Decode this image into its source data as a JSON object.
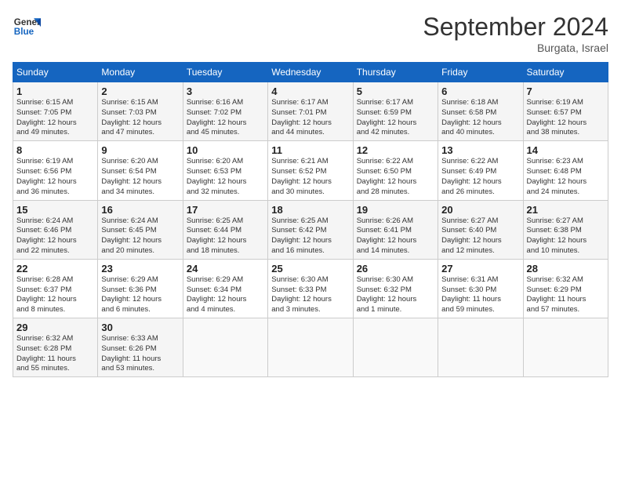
{
  "logo": {
    "line1": "General",
    "line2": "Blue"
  },
  "title": "September 2024",
  "location": "Burgata, Israel",
  "days_of_week": [
    "Sunday",
    "Monday",
    "Tuesday",
    "Wednesday",
    "Thursday",
    "Friday",
    "Saturday"
  ],
  "weeks": [
    [
      {
        "day": 1,
        "info": "Sunrise: 6:15 AM\nSunset: 7:05 PM\nDaylight: 12 hours\nand 49 minutes."
      },
      {
        "day": 2,
        "info": "Sunrise: 6:15 AM\nSunset: 7:03 PM\nDaylight: 12 hours\nand 47 minutes."
      },
      {
        "day": 3,
        "info": "Sunrise: 6:16 AM\nSunset: 7:02 PM\nDaylight: 12 hours\nand 45 minutes."
      },
      {
        "day": 4,
        "info": "Sunrise: 6:17 AM\nSunset: 7:01 PM\nDaylight: 12 hours\nand 44 minutes."
      },
      {
        "day": 5,
        "info": "Sunrise: 6:17 AM\nSunset: 6:59 PM\nDaylight: 12 hours\nand 42 minutes."
      },
      {
        "day": 6,
        "info": "Sunrise: 6:18 AM\nSunset: 6:58 PM\nDaylight: 12 hours\nand 40 minutes."
      },
      {
        "day": 7,
        "info": "Sunrise: 6:19 AM\nSunset: 6:57 PM\nDaylight: 12 hours\nand 38 minutes."
      }
    ],
    [
      {
        "day": 8,
        "info": "Sunrise: 6:19 AM\nSunset: 6:56 PM\nDaylight: 12 hours\nand 36 minutes."
      },
      {
        "day": 9,
        "info": "Sunrise: 6:20 AM\nSunset: 6:54 PM\nDaylight: 12 hours\nand 34 minutes."
      },
      {
        "day": 10,
        "info": "Sunrise: 6:20 AM\nSunset: 6:53 PM\nDaylight: 12 hours\nand 32 minutes."
      },
      {
        "day": 11,
        "info": "Sunrise: 6:21 AM\nSunset: 6:52 PM\nDaylight: 12 hours\nand 30 minutes."
      },
      {
        "day": 12,
        "info": "Sunrise: 6:22 AM\nSunset: 6:50 PM\nDaylight: 12 hours\nand 28 minutes."
      },
      {
        "day": 13,
        "info": "Sunrise: 6:22 AM\nSunset: 6:49 PM\nDaylight: 12 hours\nand 26 minutes."
      },
      {
        "day": 14,
        "info": "Sunrise: 6:23 AM\nSunset: 6:48 PM\nDaylight: 12 hours\nand 24 minutes."
      }
    ],
    [
      {
        "day": 15,
        "info": "Sunrise: 6:24 AM\nSunset: 6:46 PM\nDaylight: 12 hours\nand 22 minutes."
      },
      {
        "day": 16,
        "info": "Sunrise: 6:24 AM\nSunset: 6:45 PM\nDaylight: 12 hours\nand 20 minutes."
      },
      {
        "day": 17,
        "info": "Sunrise: 6:25 AM\nSunset: 6:44 PM\nDaylight: 12 hours\nand 18 minutes."
      },
      {
        "day": 18,
        "info": "Sunrise: 6:25 AM\nSunset: 6:42 PM\nDaylight: 12 hours\nand 16 minutes."
      },
      {
        "day": 19,
        "info": "Sunrise: 6:26 AM\nSunset: 6:41 PM\nDaylight: 12 hours\nand 14 minutes."
      },
      {
        "day": 20,
        "info": "Sunrise: 6:27 AM\nSunset: 6:40 PM\nDaylight: 12 hours\nand 12 minutes."
      },
      {
        "day": 21,
        "info": "Sunrise: 6:27 AM\nSunset: 6:38 PM\nDaylight: 12 hours\nand 10 minutes."
      }
    ],
    [
      {
        "day": 22,
        "info": "Sunrise: 6:28 AM\nSunset: 6:37 PM\nDaylight: 12 hours\nand 8 minutes."
      },
      {
        "day": 23,
        "info": "Sunrise: 6:29 AM\nSunset: 6:36 PM\nDaylight: 12 hours\nand 6 minutes."
      },
      {
        "day": 24,
        "info": "Sunrise: 6:29 AM\nSunset: 6:34 PM\nDaylight: 12 hours\nand 4 minutes."
      },
      {
        "day": 25,
        "info": "Sunrise: 6:30 AM\nSunset: 6:33 PM\nDaylight: 12 hours\nand 3 minutes."
      },
      {
        "day": 26,
        "info": "Sunrise: 6:30 AM\nSunset: 6:32 PM\nDaylight: 12 hours\nand 1 minute."
      },
      {
        "day": 27,
        "info": "Sunrise: 6:31 AM\nSunset: 6:30 PM\nDaylight: 11 hours\nand 59 minutes."
      },
      {
        "day": 28,
        "info": "Sunrise: 6:32 AM\nSunset: 6:29 PM\nDaylight: 11 hours\nand 57 minutes."
      }
    ],
    [
      {
        "day": 29,
        "info": "Sunrise: 6:32 AM\nSunset: 6:28 PM\nDaylight: 11 hours\nand 55 minutes."
      },
      {
        "day": 30,
        "info": "Sunrise: 6:33 AM\nSunset: 6:26 PM\nDaylight: 11 hours\nand 53 minutes."
      },
      null,
      null,
      null,
      null,
      null
    ]
  ]
}
